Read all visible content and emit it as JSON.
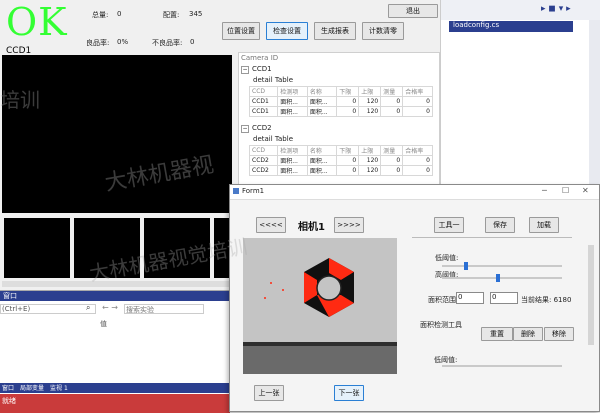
{
  "status": {
    "result": "OK",
    "ccd_label": "CCD1"
  },
  "stats": {
    "total_label": "总量:",
    "total_value": "0",
    "matched_label": "配置:",
    "matched_value": "345",
    "good_rate_label": "良品率:",
    "good_rate_value": "0%",
    "bad_rate_label": "不良品率:",
    "bad_rate_value": "0"
  },
  "toolbar": {
    "position_settings": "位置设置",
    "inspect_settings": "检查设置",
    "generate_report": "生成报表",
    "clear_count": "计数清零",
    "exit": "退出"
  },
  "camera_panel": {
    "title": "Camera ID",
    "groups": [
      {
        "name": "CCD1",
        "table_title": "detail Table",
        "headers": [
          "CCD",
          "检测项",
          "名称",
          "下限",
          "上限",
          "测量",
          "合格率"
        ],
        "rows": [
          [
            "CCD1",
            "面积...",
            "面积...",
            "0",
            "120",
            "0",
            "0"
          ],
          [
            "CCD1",
            "面积...",
            "面积...",
            "0",
            "120",
            "0",
            "0"
          ]
        ]
      },
      {
        "name": "CCD2",
        "table_title": "detail Table",
        "headers": [
          "CCD",
          "检测项",
          "名称",
          "下限",
          "上限",
          "测量",
          "合格率"
        ],
        "rows": [
          [
            "CCD2",
            "面积...",
            "面积...",
            "0",
            "120",
            "0",
            "0"
          ],
          [
            "CCD2",
            "面积...",
            "面积...",
            "0",
            "120",
            "0",
            "0"
          ]
        ]
      }
    ]
  },
  "ide": {
    "tab_file": "loadconfig.cs",
    "lower_panel_title": "窗口",
    "search_placeholder": "(Ctrl+E)",
    "search_box_placeholder": "搜索实验",
    "column_text": "值",
    "bottom_tabs": [
      "窗口",
      "局部变量",
      "监视 1"
    ],
    "status_bar": "就绪"
  },
  "form1": {
    "title": "Form1",
    "prev_camera": "<<<<",
    "camera_name": "相机1",
    "next_camera": ">>>>",
    "tool1": "工具一",
    "save": "保存",
    "load": "加载",
    "low_threshold_label": "低阈值:",
    "low_threshold_value": 0.18,
    "high_threshold_label": "高阈值:",
    "high_threshold_value": 0.45,
    "area_range_label": "面积范围:",
    "area_min": "0",
    "area_max": "0",
    "current_result_label": "当前结果: 6180",
    "area_tool_label": "面积检测工具",
    "reset": "重置",
    "delete": "删除",
    "remove": "移除",
    "low_threshold2_label": "低阈值:",
    "prev_image": "上一张",
    "next_image": "下一张"
  },
  "watermarks": [
    "大林机器视",
    "培训",
    "大林机器视觉培训"
  ],
  "colors": {
    "ok_green": "#33ff33",
    "hex_red": "#ff2a12",
    "status_bar_red": "#c93b3b",
    "ide_blue": "#2b3f8f"
  }
}
